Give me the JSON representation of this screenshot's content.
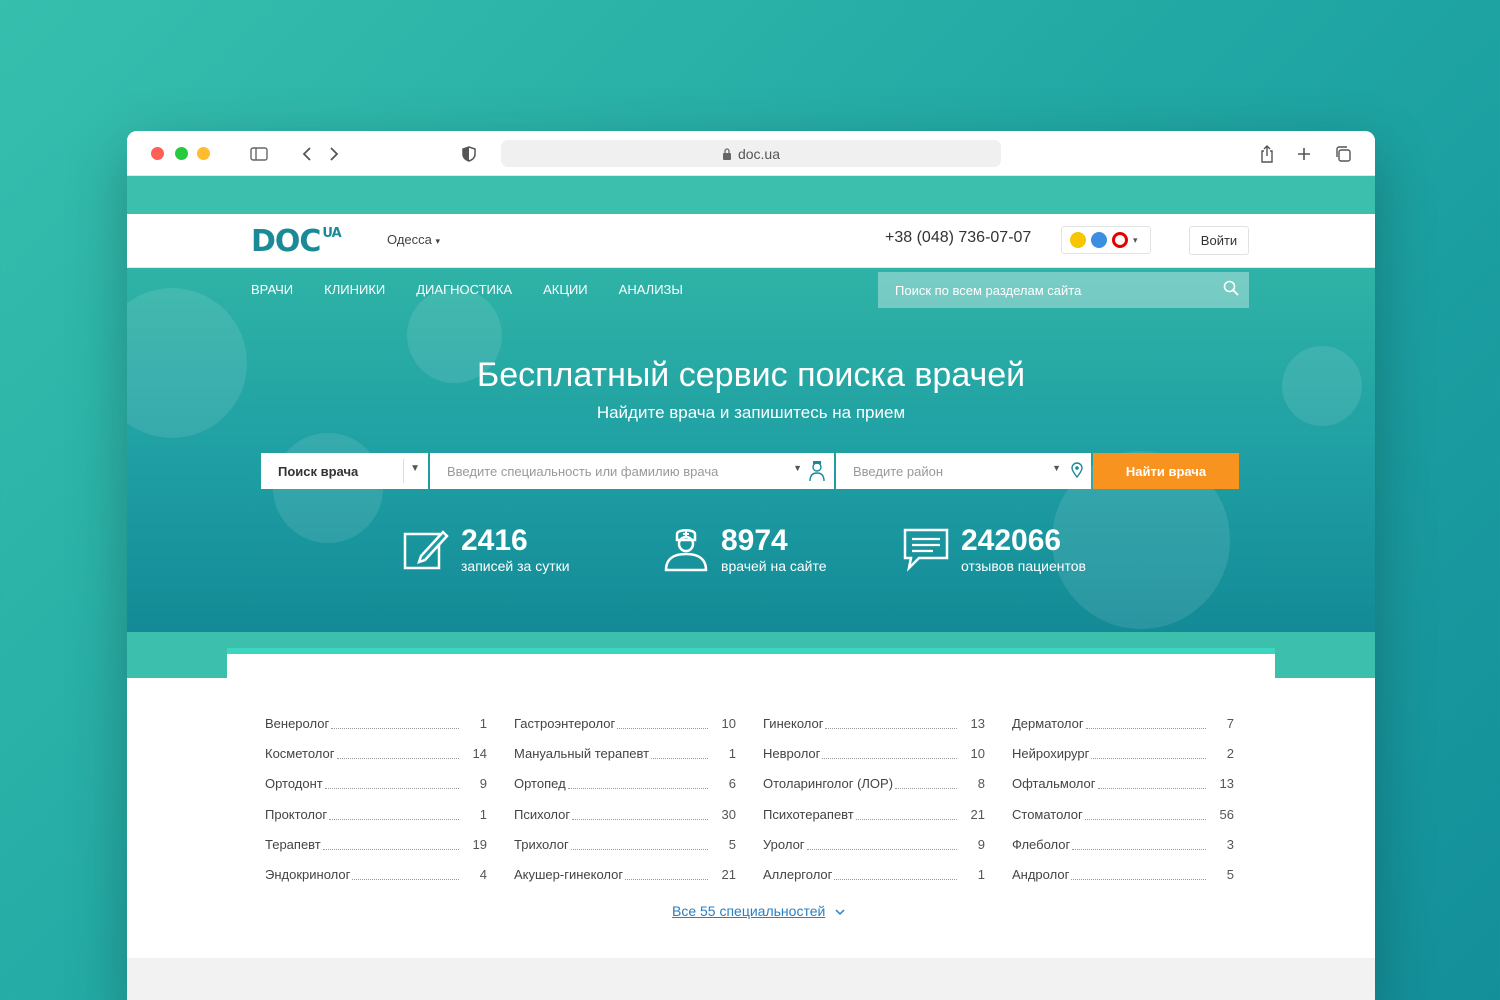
{
  "browser": {
    "url": "doc.ua"
  },
  "header": {
    "logo": "DOC",
    "logo_suffix": "UA",
    "city": "Одесса",
    "phone": "+38 (048) 736-07-07",
    "login": "Войти",
    "operator_colors": [
      "#f7c600",
      "#3a8fe3",
      "#e60000"
    ]
  },
  "nav": {
    "items": [
      "ВРАЧИ",
      "КЛИНИКИ",
      "ДИАГНОСТИКА",
      "АКЦИИ",
      "АНАЛИЗЫ"
    ],
    "search_placeholder": "Поиск по всем разделам сайта"
  },
  "hero": {
    "title": "Бесплатный сервис поиска врачей",
    "subtitle": "Найдите врача и запишитесь на прием",
    "search_type": "Поиск врача",
    "spec_placeholder": "Введите специальность или фамилию врача",
    "area_placeholder": "Введите район",
    "find_button": "Найти врача"
  },
  "stats": [
    {
      "num": "2416",
      "label": "записей за сутки"
    },
    {
      "num": "8974",
      "label": "врачей на сайте"
    },
    {
      "num": "242066",
      "label": "отзывов пациентов"
    }
  ],
  "specialties": [
    [
      {
        "name": "Венеролог",
        "count": "1"
      },
      {
        "name": "Косметолог",
        "count": "14"
      },
      {
        "name": "Ортодонт",
        "count": "9"
      },
      {
        "name": "Проктолог",
        "count": "1"
      },
      {
        "name": "Терапевт",
        "count": "19"
      },
      {
        "name": "Эндокринолог",
        "count": "4"
      }
    ],
    [
      {
        "name": "Гастроэнтеролог",
        "count": "10"
      },
      {
        "name": "Мануальный терапевт",
        "count": "1"
      },
      {
        "name": "Ортопед",
        "count": "6"
      },
      {
        "name": "Психолог",
        "count": "30"
      },
      {
        "name": "Трихолог",
        "count": "5"
      },
      {
        "name": "Акушер-гинеколог",
        "count": "21"
      }
    ],
    [
      {
        "name": "Гинеколог",
        "count": "13"
      },
      {
        "name": "Невролог",
        "count": "10"
      },
      {
        "name": "Отоларинголог (ЛОР)",
        "count": "8"
      },
      {
        "name": "Психотерапевт",
        "count": "21"
      },
      {
        "name": "Уролог",
        "count": "9"
      },
      {
        "name": "Аллерголог",
        "count": "1"
      }
    ],
    [
      {
        "name": "Дерматолог",
        "count": "7"
      },
      {
        "name": "Нейрохирург",
        "count": "2"
      },
      {
        "name": "Офтальмолог",
        "count": "13"
      },
      {
        "name": "Стоматолог",
        "count": "56"
      },
      {
        "name": "Флеболог",
        "count": "3"
      },
      {
        "name": "Андролог",
        "count": "5"
      }
    ]
  ],
  "all_link": "Все 55 специальностей",
  "colors": {
    "brand": "#1b8a98",
    "accent": "#3dbfad",
    "button": "#f7931e",
    "link": "#2a7fc1"
  }
}
